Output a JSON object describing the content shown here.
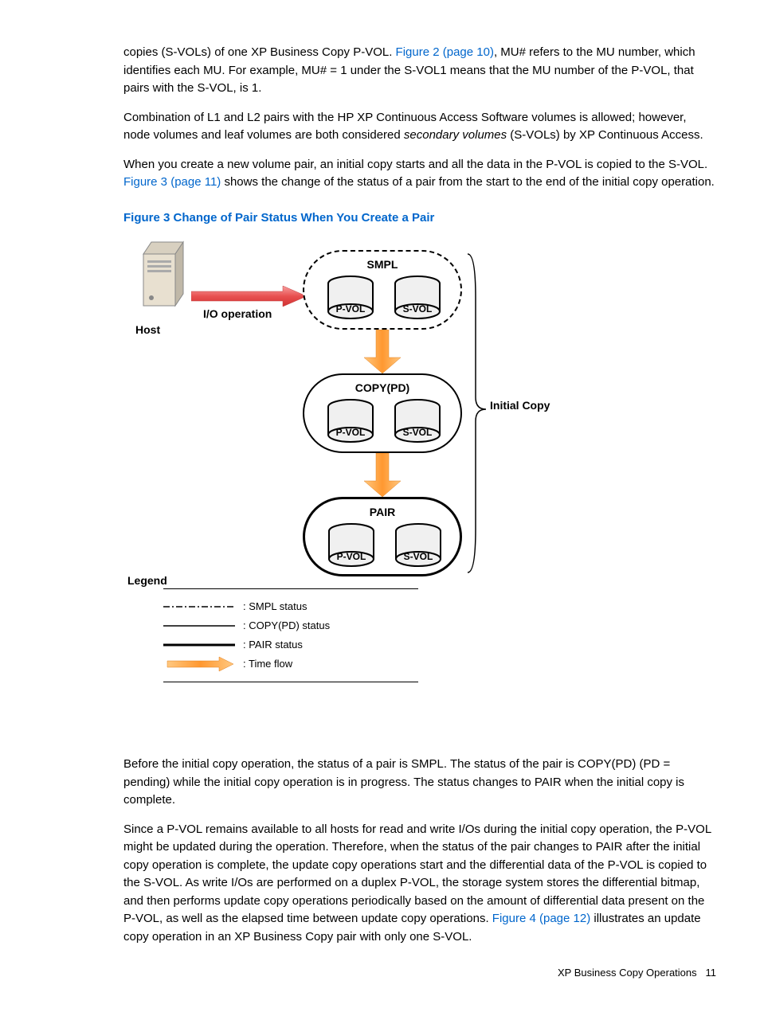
{
  "para1_a": "copies (S-VOLs) of one XP Business Copy P-VOL. ",
  "para1_link": "Figure 2 (page 10)",
  "para1_b": ", MU# refers to the MU number, which identifies each MU. For example, MU# = 1 under the S-VOL1 means that the MU number of the P-VOL, that pairs with the S-VOL, is 1.",
  "para2_a": "Combination of L1 and L2 pairs with the HP XP Continuous Access Software volumes is allowed; however, node volumes and leaf volumes are both considered ",
  "para2_i": "secondary volumes",
  "para2_b": " (S-VOLs) by XP Continuous Access.",
  "para3_a": "When you create a new volume pair, an initial copy starts and all the data in the P-VOL is copied to the S-VOL. ",
  "para3_link": "Figure 3 (page 11)",
  "para3_b": " shows the change of the status of a pair from the start to the end of the initial copy operation.",
  "figure_caption": "Figure 3 Change of Pair Status When You Create a Pair",
  "diagram": {
    "host": "Host",
    "io": "I/O operation",
    "smpl": "SMPL",
    "copypd": "COPY(PD)",
    "pair": "PAIR",
    "pvol": "P-VOL",
    "svol": "S-VOL",
    "initial_copy": "Initial Copy",
    "legend_title": "Legend",
    "legend_smpl": ": SMPL status",
    "legend_copypd": ": COPY(PD) status",
    "legend_pair": ": PAIR status",
    "legend_time": ": Time flow"
  },
  "para4": "Before the initial copy operation, the status of a pair is SMPL. The status of the pair is COPY(PD) (PD = pending) while the initial copy operation is in progress. The status changes to PAIR when the initial copy is complete.",
  "para5_a": "Since a P-VOL remains available to all hosts for read and write I/Os during the initial copy operation, the P-VOL might be updated during the operation. Therefore, when the status of the pair changes to PAIR after the initial copy operation is complete, the update copy operations start and the differential data of the P-VOL is copied to the S-VOL. As write I/Os are performed on a duplex P-VOL, the storage system stores the differential bitmap, and then performs update copy operations periodically based on the amount of differential data present on the P-VOL, as well as the elapsed time between update copy operations. ",
  "para5_link": "Figure 4 (page 12)",
  "para5_b": " illustrates an update copy operation in an XP Business Copy pair with only one S-VOL.",
  "footer_text": "XP Business Copy Operations",
  "footer_page": "11"
}
